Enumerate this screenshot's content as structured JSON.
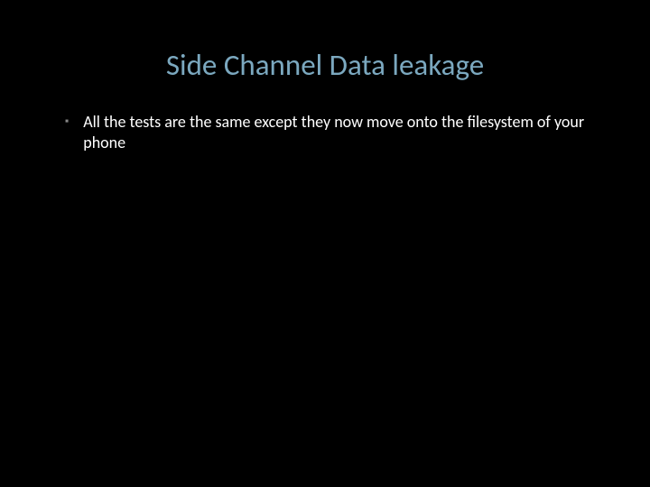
{
  "slide": {
    "title": "Side Channel Data leakage",
    "bullets": [
      {
        "text": "All the tests are the same except they now move onto the filesystem of your phone"
      }
    ]
  }
}
